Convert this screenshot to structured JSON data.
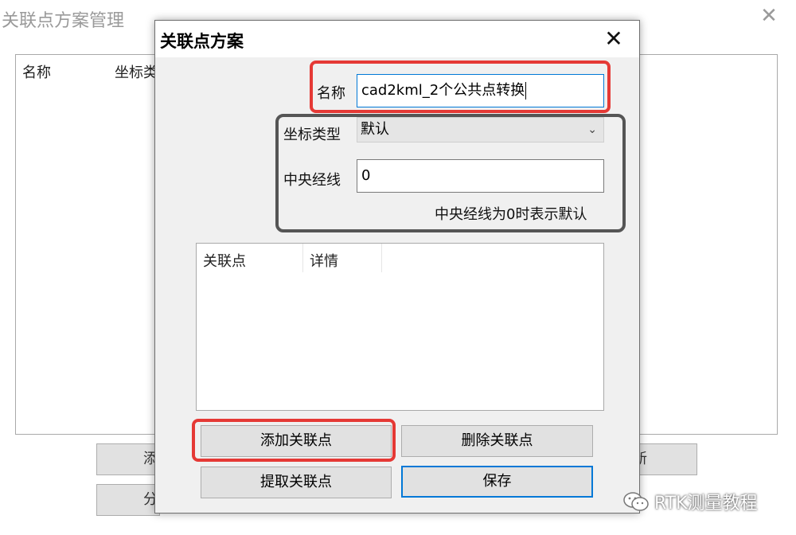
{
  "background_window": {
    "title": "关联点方案管理",
    "columns": [
      "名称",
      "坐标类"
    ],
    "buttons_partial": [
      "添",
      "分",
      "新"
    ]
  },
  "dialog": {
    "title": "关联点方案",
    "name_label": "名称",
    "name_value": "cad2kml_2个公共点转换",
    "coord_type_label": "坐标类型",
    "coord_type_value": "默认",
    "meridian_label": "中央经线",
    "meridian_value": "0",
    "meridian_hint": "中央经线为0时表示默认",
    "list_columns": [
      "关联点",
      "详情"
    ],
    "buttons": {
      "add": "添加关联点",
      "delete": "删除关联点",
      "extract": "提取关联点",
      "save": "保存"
    }
  },
  "watermark": "RTK测量教程",
  "colors": {
    "highlight_red": "#e53935",
    "highlight_gray": "#555555",
    "accent_blue": "#0078d7"
  }
}
